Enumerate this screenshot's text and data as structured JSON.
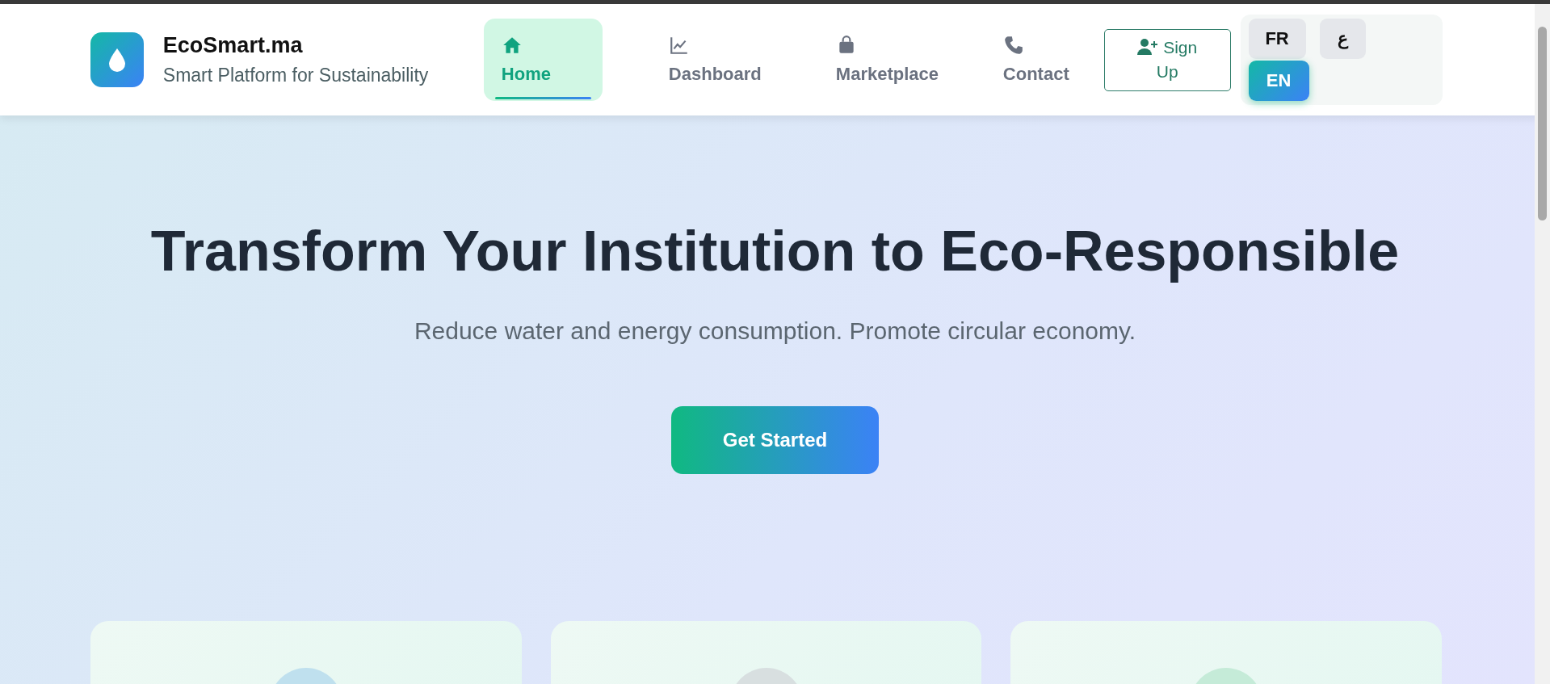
{
  "brand": {
    "name": "EcoSmart.ma",
    "tagline": "Smart Platform for Sustainability"
  },
  "nav": [
    {
      "label": "Home",
      "selected": true
    },
    {
      "label": "Dashboard",
      "selected": false
    },
    {
      "label": "Marketplace",
      "selected": false
    },
    {
      "label": "Contact",
      "selected": false
    }
  ],
  "signup": {
    "label": "Sign Up"
  },
  "languages": [
    {
      "label": "FR",
      "selected": false
    },
    {
      "label": "ع",
      "selected": false
    },
    {
      "label": "EN",
      "selected": true
    }
  ],
  "hero": {
    "title": "Transform Your Institution to Eco-Responsible",
    "subtitle": "Reduce water and energy consumption. Promote circular economy.",
    "button": "Get Started"
  },
  "cards": [
    {
      "color": "#bfe0ee"
    },
    {
      "color": "#d8dfe0"
    },
    {
      "color": "#c5ebd8"
    }
  ]
}
